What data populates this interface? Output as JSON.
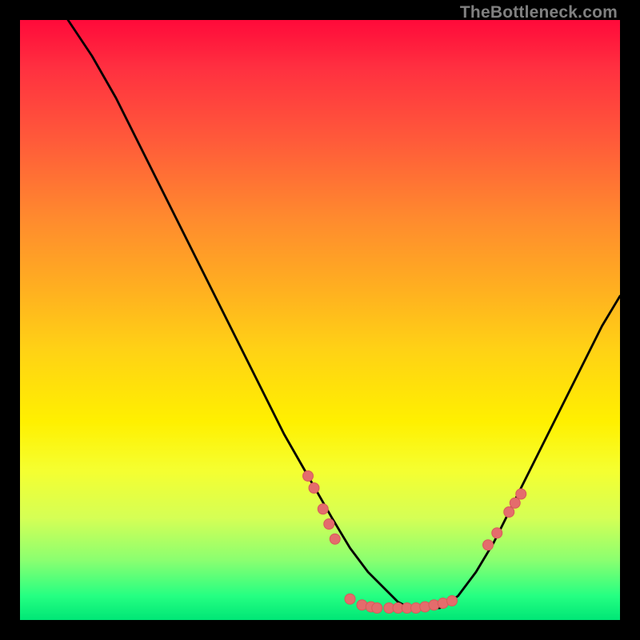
{
  "watermark": "TheBottleneck.com",
  "colors": {
    "background": "#000000",
    "curve": "#000000",
    "marker": "#e46c6c",
    "marker_outline": "#d85a5a",
    "gradient_top": "#ff0a3a",
    "gradient_bottom": "#00e676"
  },
  "chart_data": {
    "type": "line",
    "title": "",
    "xlabel": "",
    "ylabel": "",
    "xlim": [
      0,
      100
    ],
    "ylim": [
      0,
      100
    ],
    "curve": {
      "x": [
        8,
        12,
        16,
        20,
        24,
        28,
        32,
        36,
        40,
        44,
        48,
        52,
        55,
        58,
        61,
        63,
        65,
        67,
        70,
        73,
        76,
        79,
        82,
        85,
        88,
        91,
        94,
        97,
        100
      ],
      "y": [
        100,
        94,
        87,
        79,
        71,
        63,
        55,
        47,
        39,
        31,
        24,
        17,
        12,
        8,
        5,
        3,
        2,
        2,
        2,
        4,
        8,
        13,
        19,
        25,
        31,
        37,
        43,
        49,
        54
      ]
    },
    "markers": [
      {
        "x": 48.0,
        "y": 24.0
      },
      {
        "x": 49.0,
        "y": 22.0
      },
      {
        "x": 50.5,
        "y": 18.5
      },
      {
        "x": 51.5,
        "y": 16.0
      },
      {
        "x": 52.5,
        "y": 13.5
      },
      {
        "x": 55.0,
        "y": 3.5
      },
      {
        "x": 57.0,
        "y": 2.5
      },
      {
        "x": 58.5,
        "y": 2.2
      },
      {
        "x": 59.5,
        "y": 2.0
      },
      {
        "x": 61.5,
        "y": 2.0
      },
      {
        "x": 63.0,
        "y": 2.0
      },
      {
        "x": 64.5,
        "y": 2.0
      },
      {
        "x": 66.0,
        "y": 2.0
      },
      {
        "x": 67.5,
        "y": 2.2
      },
      {
        "x": 69.0,
        "y": 2.5
      },
      {
        "x": 70.5,
        "y": 2.8
      },
      {
        "x": 72.0,
        "y": 3.2
      },
      {
        "x": 78.0,
        "y": 12.5
      },
      {
        "x": 79.5,
        "y": 14.5
      },
      {
        "x": 81.5,
        "y": 18.0
      },
      {
        "x": 82.5,
        "y": 19.5
      },
      {
        "x": 83.5,
        "y": 21.0
      }
    ]
  }
}
